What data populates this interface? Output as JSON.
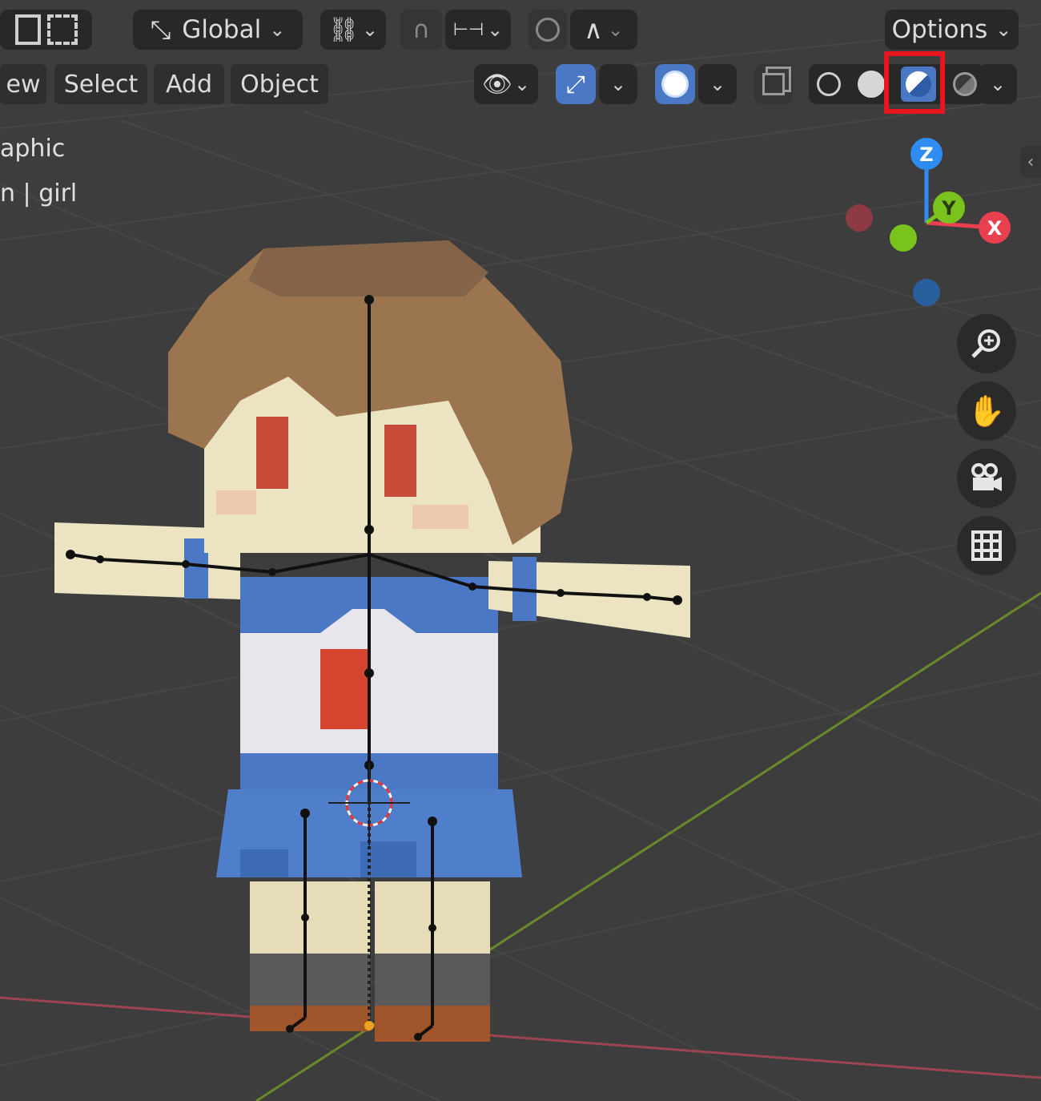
{
  "header": {
    "transform_orientation": "Global",
    "options_label": "Options"
  },
  "menu": {
    "view_label": "ew",
    "select_label": "Select",
    "add_label": "Add",
    "object_label": "Object"
  },
  "overlay": {
    "view_mode_fragment": "aphic",
    "collection_fragment": "n | girl"
  },
  "gizmo": {
    "z_label": "Z",
    "y_label": "Y",
    "x_label": "X"
  },
  "shading": {
    "active_mode": "material-preview",
    "highlight_color": "#e8141e"
  },
  "colors": {
    "background": "#3d3d3d",
    "active_blue": "#4a78c4",
    "axis_x": "#e8404f",
    "axis_y": "#7ac21c",
    "axis_z": "#2f8cf2"
  }
}
